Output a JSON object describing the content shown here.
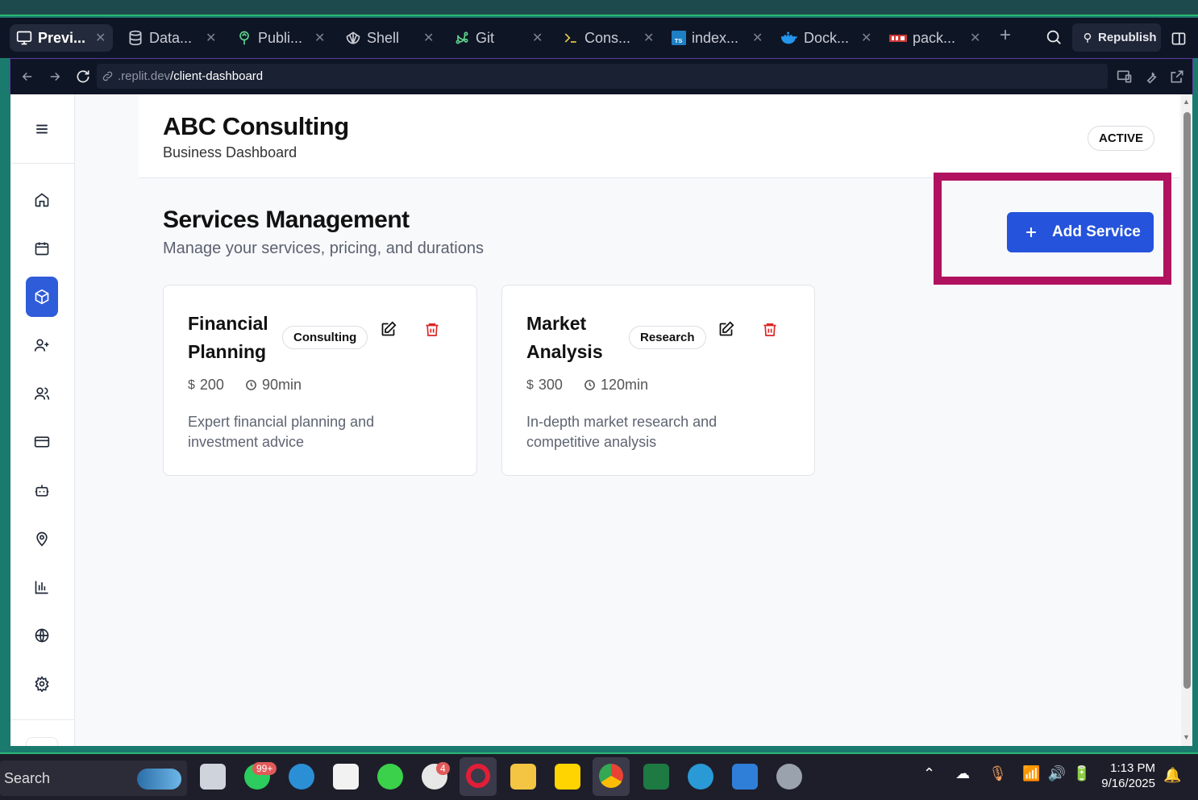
{
  "tabs": [
    {
      "label": "Previ...",
      "icon": "monitor-icon",
      "active": true
    },
    {
      "label": "Data...",
      "icon": "database-icon"
    },
    {
      "label": "Publi...",
      "icon": "publish-icon"
    },
    {
      "label": "Shell",
      "icon": "shell-icon"
    },
    {
      "label": "Git",
      "icon": "git-icon"
    },
    {
      "label": "Cons...",
      "icon": "console-icon"
    },
    {
      "label": "index...",
      "icon": "typescript-file-icon"
    },
    {
      "label": "Dock...",
      "icon": "docker-icon"
    },
    {
      "label": "pack...",
      "icon": "npm-icon"
    }
  ],
  "toolbar": {
    "republish_label": "Republish"
  },
  "url": {
    "domain": ".replit.dev",
    "path": "/client-dashboard"
  },
  "header": {
    "company": "ABC Consulting",
    "subtitle": "Business Dashboard",
    "status": "ACTIVE"
  },
  "main": {
    "title": "Services Management",
    "description": "Manage your services, pricing, and durations",
    "add_label": "Add Service"
  },
  "services": [
    {
      "name": "Financial Planning",
      "category": "Consulting",
      "price": "200",
      "duration": "90min",
      "description": "Expert financial planning and investment advice"
    },
    {
      "name": "Market Analysis",
      "category": "Research",
      "price": "300",
      "duration": "120min",
      "description": "In-depth market research and competitive analysis"
    }
  ],
  "sidebar_icons": [
    "home-icon",
    "calendar-icon",
    "package-icon",
    "user-plus-icon",
    "users-icon",
    "credit-card-icon",
    "bot-icon",
    "map-pin-icon",
    "bar-chart-icon",
    "globe-icon",
    "settings-icon"
  ],
  "taskbar": {
    "search_placeholder": "Search",
    "whatsapp_badge": "99+",
    "slack_badge": "4",
    "time": "1:13 PM",
    "date": "9/16/2025"
  },
  "colors": {
    "primary": "#2553dc",
    "highlight": "#b0125f",
    "danger": "#dc2626"
  }
}
